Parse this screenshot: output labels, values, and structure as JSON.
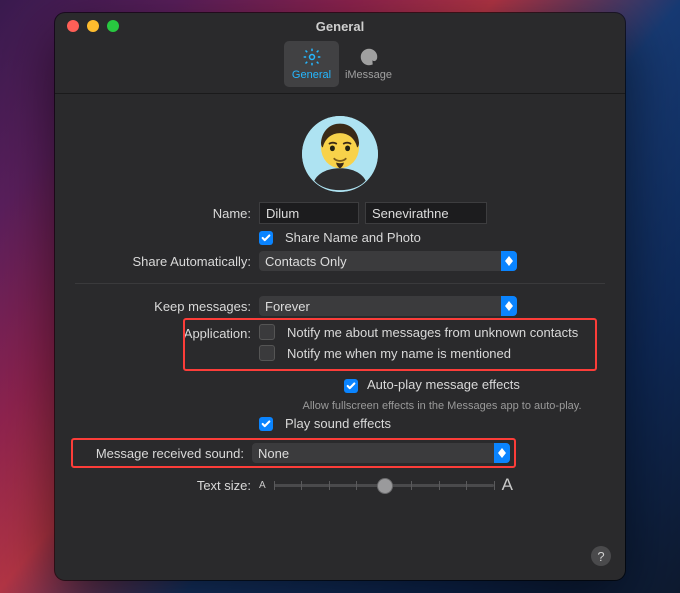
{
  "window": {
    "title": "General"
  },
  "tabs": {
    "general": "General",
    "imessage": "iMessage"
  },
  "name": {
    "label": "Name:",
    "first": "Dilum",
    "last": "Senevirathne",
    "share_label": "Share Name and Photo",
    "share_auto_label": "Share Automatically:",
    "share_auto_value": "Contacts Only"
  },
  "keep": {
    "label": "Keep messages:",
    "value": "Forever"
  },
  "app": {
    "label": "Application:",
    "unknown": "Notify me about messages from unknown contacts",
    "mention": "Notify me when my name is mentioned",
    "autoplay": "Auto-play message effects",
    "autoplay_sub": "Allow fullscreen effects in the Messages app to auto-play.",
    "sound": "Play sound effects"
  },
  "received": {
    "label": "Message received sound:",
    "value": "None"
  },
  "textsize": {
    "label": "Text size:",
    "smallA": "A",
    "bigA": "A"
  }
}
